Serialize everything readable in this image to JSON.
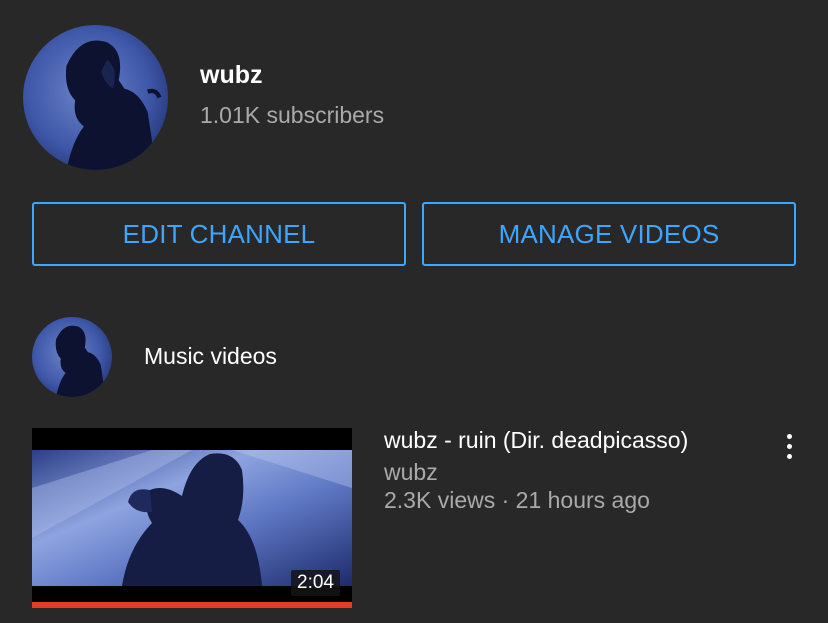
{
  "channel": {
    "name": "wubz",
    "subscribers": "1.01K subscribers",
    "avatar_icon": "hooded-figure-avatar"
  },
  "actions": {
    "edit_label": "EDIT CHANNEL",
    "manage_label": "MANAGE VIDEOS",
    "accent_color": "#3ea6ff"
  },
  "playlist": {
    "title": "Music videos",
    "avatar_icon": "hooded-figure-avatar"
  },
  "video": {
    "title": "wubz - ruin (Dir. deadpicasso)",
    "channel": "wubz",
    "meta": "2.3K views · 21 hours ago",
    "duration": "2:04",
    "watch_progress": 1.0,
    "progress_color": "#e53929",
    "menu_icon": "more-vert-icon"
  }
}
